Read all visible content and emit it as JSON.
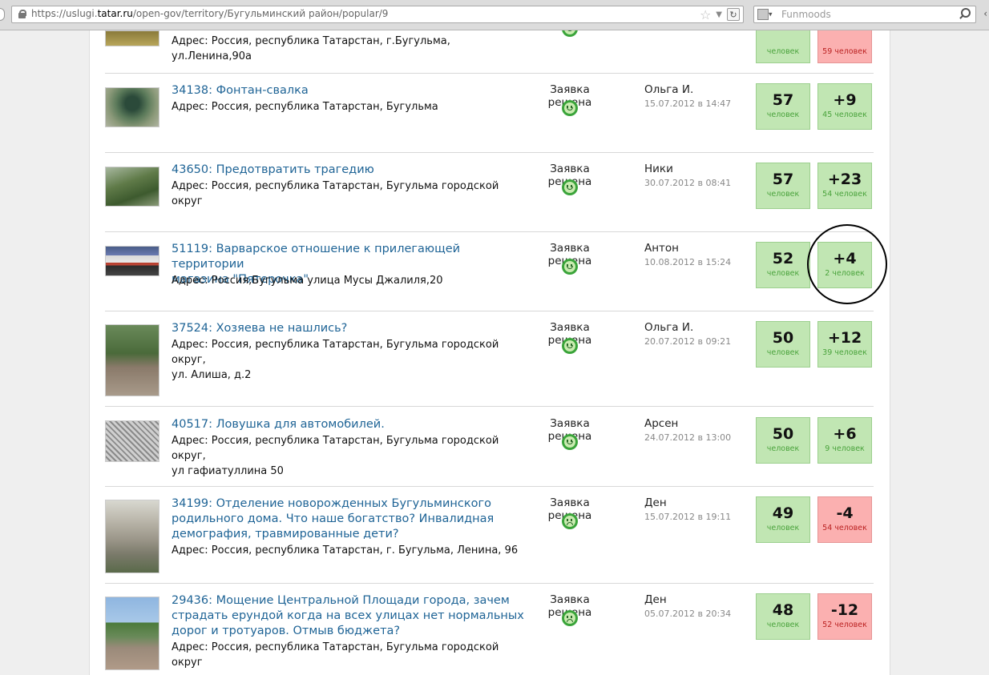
{
  "browser": {
    "url_prefix": "https://uslugi.",
    "url_domain": "tatar.ru",
    "url_path": "/open-gov/territory/Бугульминский район/popular/9",
    "search_placeholder": "Funmoods"
  },
  "rows": [
    {
      "id_title": "",
      "address": "Адрес: Россия, республика Татарстан, г.Бугульма,",
      "address2": "ул.Ленина,90а",
      "status": "",
      "author": "",
      "date": "",
      "votes": "",
      "votes_label": "человек",
      "rating": "",
      "rating_label": "59 человек",
      "mood": "happy",
      "rating_color": "red"
    },
    {
      "id_title": "34138: Фонтан-свалка",
      "address": "Адрес: Россия, республика Татарстан, Бугульма",
      "status": "Заявка решена",
      "author": "Ольга И.",
      "date": "15.07.2012 в 14:47",
      "votes": "57",
      "votes_label": "человек",
      "rating": "+9",
      "rating_label": "45 человек",
      "mood": "happy",
      "rating_color": "green"
    },
    {
      "id_title": "43650: Предотвратить трагедию",
      "address": "Адрес: Россия, республика Татарстан, Бугульма городской округ",
      "status": "Заявка решена",
      "author": "Ники",
      "date": "30.07.2012 в 08:41",
      "votes": "57",
      "votes_label": "человек",
      "rating": "+23",
      "rating_label": "54 человек",
      "mood": "happy",
      "rating_color": "green"
    },
    {
      "id_title": "51119: Варварское отношение к прилегающей территории",
      "id_title2": "магазина \"Пятерочка\"",
      "address": "Адрес: Россия,Бугульма улица Мусы Джалиля,20",
      "status": "Заявка решена",
      "author": "Антон",
      "date": "10.08.2012 в 15:24",
      "votes": "52",
      "votes_label": "человек",
      "rating": "+4",
      "rating_label": "2 человек",
      "mood": "happy",
      "rating_color": "green"
    },
    {
      "id_title": "37524: Хозяева не нашлись?",
      "address": "Адрес: Россия, республика Татарстан, Бугульма городской округ,",
      "address2": "ул. Алиша, д.2",
      "status": "Заявка решена",
      "author": "Ольга И.",
      "date": "20.07.2012 в 09:21",
      "votes": "50",
      "votes_label": "человек",
      "rating": "+12",
      "rating_label": "39 человек",
      "mood": "happy",
      "rating_color": "green"
    },
    {
      "id_title": "40517: Ловушка для автомобилей.",
      "address": "Адрес: Россия, республика Татарстан, Бугульма городской округ,",
      "address2": "ул гафиатуллина 50",
      "status": "Заявка решена",
      "author": "Арсен",
      "date": "24.07.2012 в 13:00",
      "votes": "50",
      "votes_label": "человек",
      "rating": "+6",
      "rating_label": "9 человек",
      "mood": "happy",
      "rating_color": "green"
    },
    {
      "id_title": "34199: Отделение новорожденных Бугульминского",
      "id_title2": "родильного дома. Что наше богатство? Инвалидная",
      "id_title3": "демография, травмированные дети?",
      "address": "Адрес: Россия, республика Татарстан, г. Бугульма, Ленина, 96",
      "status": "Заявка решена",
      "author": "Ден",
      "date": "15.07.2012 в 19:11",
      "votes": "49",
      "votes_label": "человек",
      "rating": "-4",
      "rating_label": "54 человек",
      "mood": "sad",
      "rating_color": "red"
    },
    {
      "id_title": "29436: Мощение Центральной Площади города, зачем",
      "id_title2": "страдать ерундой когда на всех улицах нет нормальных",
      "id_title3": "дорог и тротуаров. Отмыв бюджета?",
      "address": "Адрес: Россия, республика Татарстан, Бугульма городской округ",
      "status": "Заявка решена",
      "author": "Ден",
      "date": "05.07.2012 в 20:34",
      "votes": "48",
      "votes_label": "человек",
      "rating": "-12",
      "rating_label": "52 человек",
      "mood": "sad",
      "rating_color": "red"
    }
  ]
}
